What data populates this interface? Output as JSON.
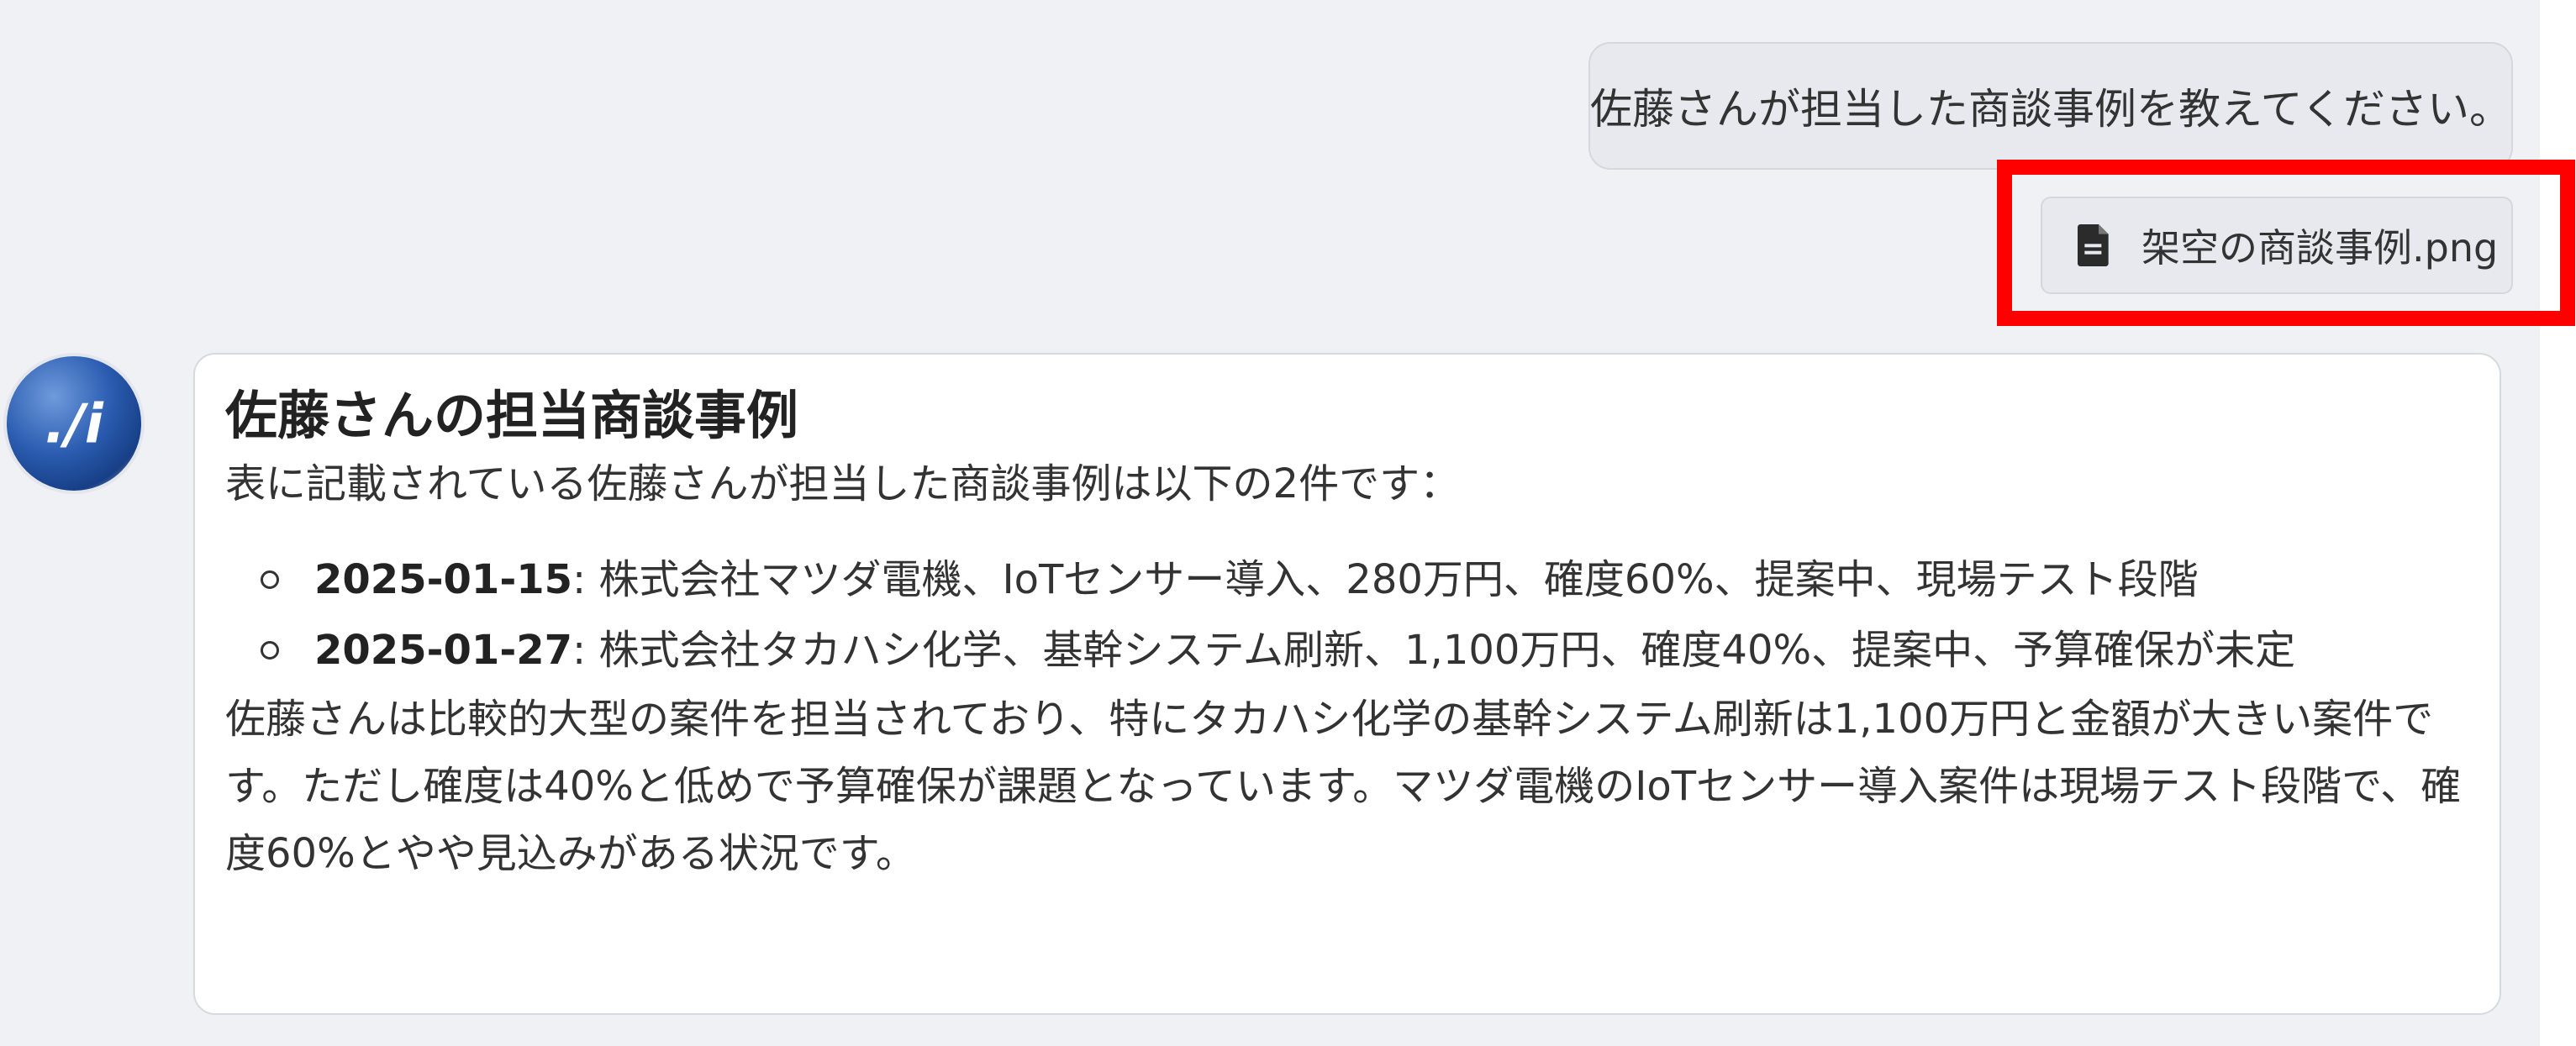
{
  "user_message": {
    "text": "佐藤さんが担当した商談事例を教えてください。"
  },
  "attachment": {
    "icon": "file-icon",
    "filename": "架空の商談事例.png"
  },
  "highlight": {
    "color": "#ff0000"
  },
  "assistant": {
    "avatar_label": "./i",
    "title": "佐藤さんの担当商談事例",
    "intro": "表に記載されている佐藤さんが担当した商談事例は以下の2件です：",
    "cases": [
      {
        "date": "2025-01-15",
        "detail": ": 株式会社マツダ電機、IoTセンサー導入、280万円、確度60%、提案中、現場テスト段階"
      },
      {
        "date": "2025-01-27",
        "detail": ": 株式会社タカハシ化学、基幹システム刷新、1,100万円、確度40%、提案中、予算確保が未定"
      }
    ],
    "summary": "佐藤さんは比較的大型の案件を担当されており、特にタカハシ化学の基幹システム刷新は1,100万円と金額が大きい案件です。ただし確度は40%と低めで予算確保が課題となっています。マツダ電機のIoTセンサー導入案件は現場テスト段階で、確度60%とやや見込みがある状況です。"
  }
}
